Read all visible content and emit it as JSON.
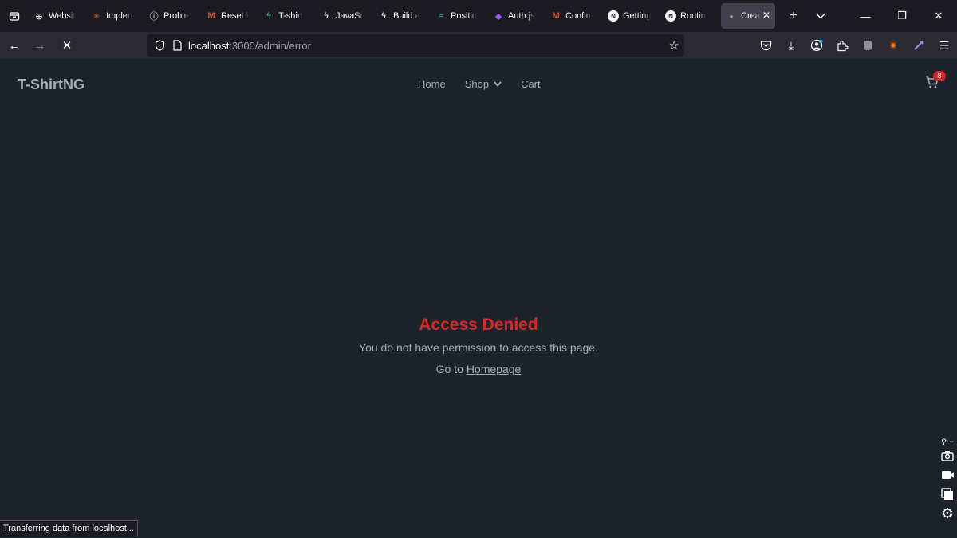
{
  "browser": {
    "tabs": [
      {
        "label": "Websit",
        "icon": "globe-icon",
        "color": "#fbfbfe"
      },
      {
        "label": "Implen",
        "icon": "sparkle-icon",
        "color": "#e8704a"
      },
      {
        "label": "Proble",
        "icon": "info-icon",
        "color": "#fbfbfe"
      },
      {
        "label": "Reset \\",
        "icon": "gmail-icon",
        "color": "#ea4335"
      },
      {
        "label": "T-shirt",
        "icon": "bolt-icon",
        "color": "#34d399"
      },
      {
        "label": "JavaSc",
        "icon": "bolt-icon",
        "color": "#fbfbfe"
      },
      {
        "label": "Build a",
        "icon": "bolt-icon",
        "color": "#fbfbfe"
      },
      {
        "label": "Positio",
        "icon": "tailwind-icon",
        "color": "#38bdf8"
      },
      {
        "label": "Auth.js",
        "icon": "shield-icon",
        "color": "#a855f7"
      },
      {
        "label": "Confirr",
        "icon": "gmail-icon",
        "color": "#ea4335"
      },
      {
        "label": "Getting",
        "icon": "nextjs-icon",
        "color": "#fbfbfe"
      },
      {
        "label": "Routin",
        "icon": "nextjs-icon",
        "color": "#fbfbfe"
      }
    ],
    "active_tab": {
      "label": "Crea",
      "icon": "loading-dot-icon"
    },
    "url": {
      "host": "localhost",
      "path": ":3000/admin/error"
    },
    "status_text": "Transferring data from localhost..."
  },
  "site": {
    "brand": "T-ShirtNG",
    "nav": {
      "home": "Home",
      "shop": "Shop",
      "cart": "Cart"
    },
    "cart_count": "8"
  },
  "error": {
    "title": "Access Denied",
    "message": "You do not have permission to access this page.",
    "go_to": "Go to",
    "home_link": "Homepage"
  },
  "colors": {
    "error": "#dc2626",
    "background": "#1d232a",
    "text": "#a6adbb"
  }
}
